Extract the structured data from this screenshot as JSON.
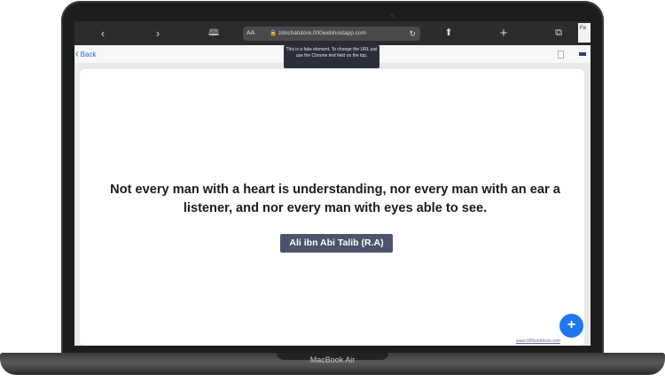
{
  "browser": {
    "url": "zdnchatstore.000webhostapp.com",
    "aa_label": "AA",
    "tab_fragment": "Fe",
    "tooltip": "This is a fake element. To change the URL just use the Chrome text field on the top.",
    "icons": [
      "chevron-left-icon",
      "chevron-right-icon",
      "book-icon",
      "lock-icon",
      "reload-icon",
      "share-icon",
      "plus-icon",
      "tabs-icon"
    ]
  },
  "nav": {
    "back_label": "Back"
  },
  "content": {
    "quote": "Not every man with a heart is understanding, nor every man with an ear a listener, and nor every man with eyes able to see.",
    "author": "Ali ibn Abi Talib (R.A)",
    "fab_label": "+",
    "footer_link": "www.000webhost.com"
  },
  "device": {
    "label": "MacBook Air"
  },
  "colors": {
    "accent": "#1f76f0",
    "author_badge": "#4e536c",
    "toolbar": "#2c2c2e"
  }
}
